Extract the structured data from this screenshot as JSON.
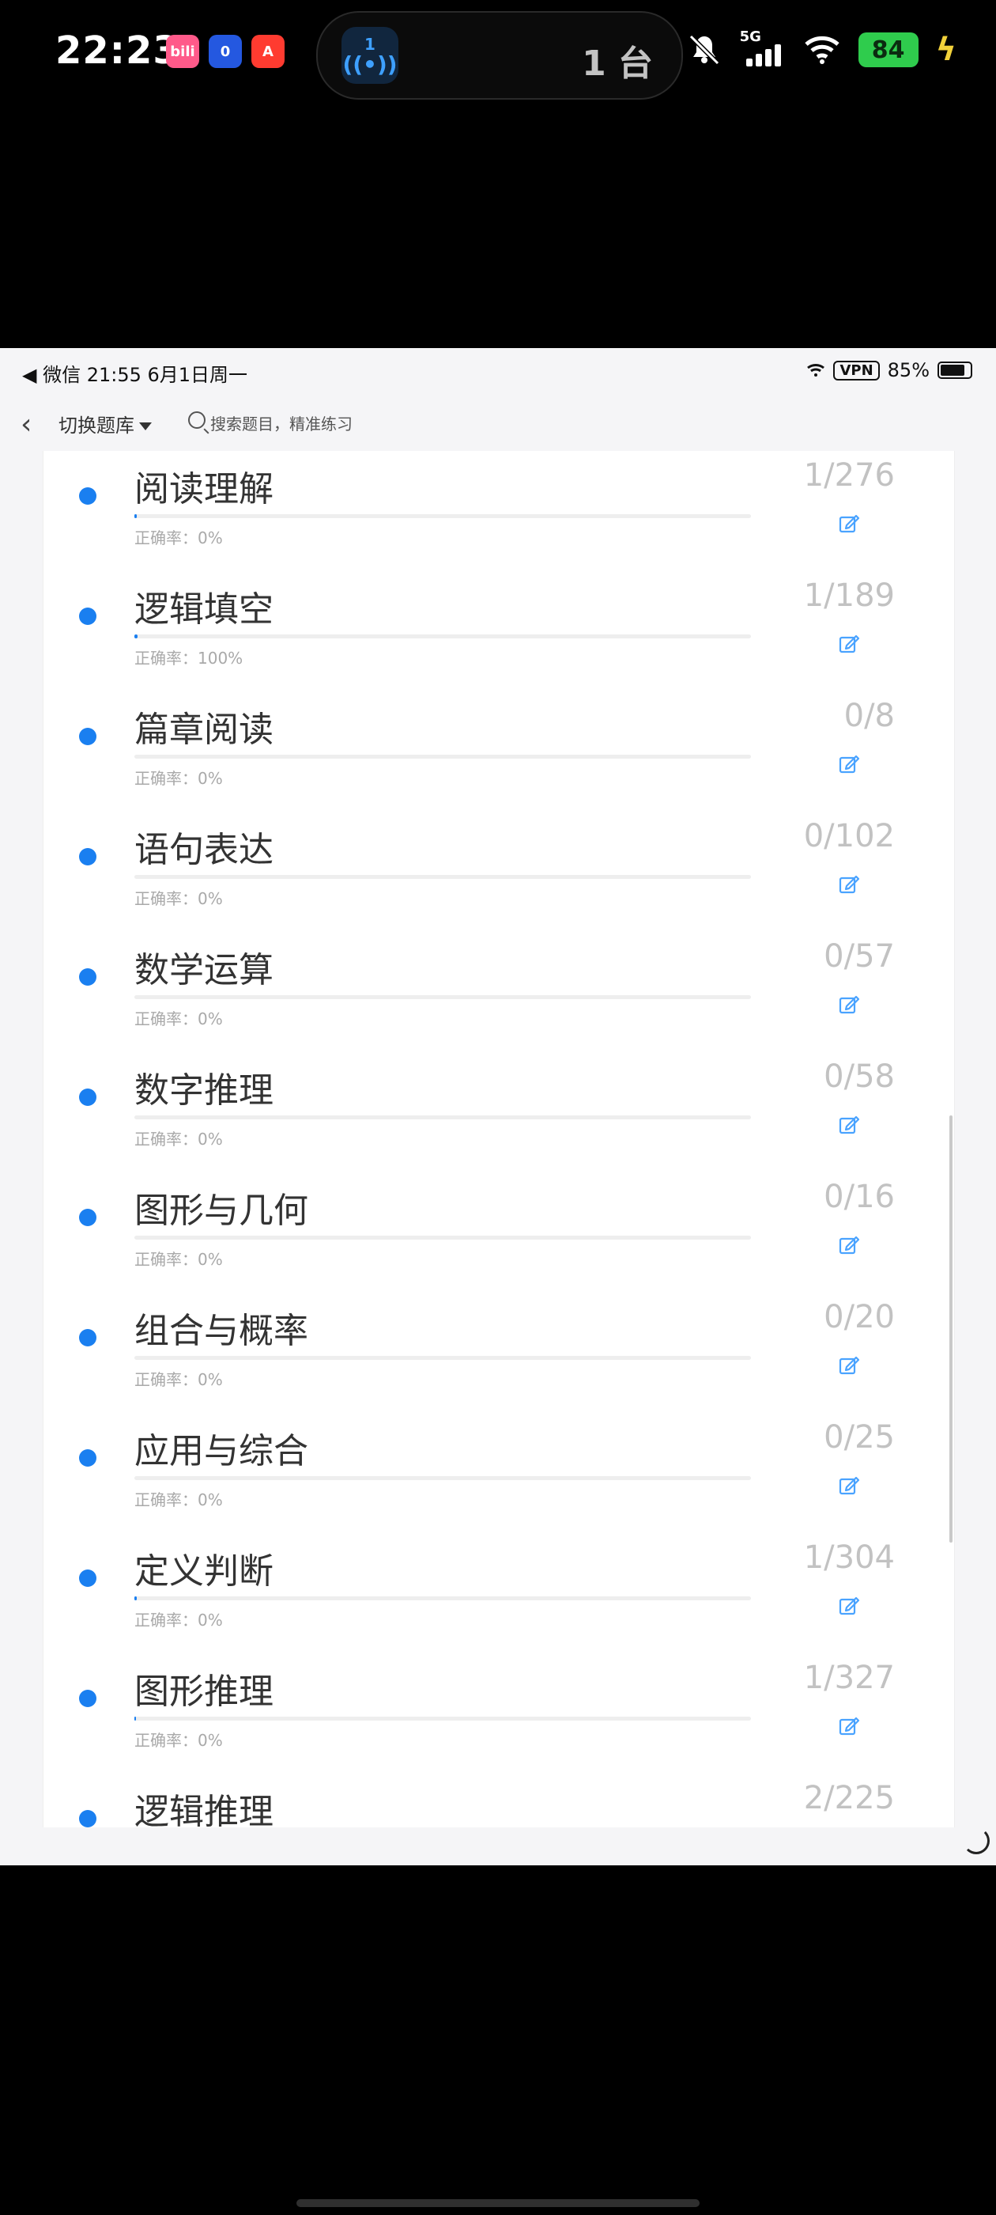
{
  "phone_status": {
    "time": "22:23",
    "cast_badge_number": "1",
    "devices_text": "1 台",
    "network_type": "5G",
    "battery": "84"
  },
  "inner_status": {
    "left_text": "◀ 微信   21:55   6月1日周一",
    "vpn": "VPN",
    "battery": "85%"
  },
  "inner_nav": {
    "back_icon": "chevron-left-icon",
    "title": "切换题库",
    "search_placeholder": "搜索题目，精准练习"
  },
  "list_items": [
    {
      "title": "阅读理解",
      "accuracy": "正确率：0%",
      "count": "1/276",
      "progress": 0.0036
    },
    {
      "title": "逻辑填空",
      "accuracy": "正确率：100%",
      "count": "1/189",
      "progress": 0.0053
    },
    {
      "title": "篇章阅读",
      "accuracy": "正确率：0%",
      "count": "0/8",
      "progress": 0
    },
    {
      "title": "语句表达",
      "accuracy": "正确率：0%",
      "count": "0/102",
      "progress": 0
    },
    {
      "title": "数学运算",
      "accuracy": "正确率：0%",
      "count": "0/57",
      "progress": 0
    },
    {
      "title": "数字推理",
      "accuracy": "正确率：0%",
      "count": "0/58",
      "progress": 0
    },
    {
      "title": "图形与几何",
      "accuracy": "正确率：0%",
      "count": "0/16",
      "progress": 0
    },
    {
      "title": "组合与概率",
      "accuracy": "正确率：0%",
      "count": "0/20",
      "progress": 0
    },
    {
      "title": "应用与综合",
      "accuracy": "正确率：0%",
      "count": "0/25",
      "progress": 0
    },
    {
      "title": "定义判断",
      "accuracy": "正确率：0%",
      "count": "1/304",
      "progress": 0.0033
    },
    {
      "title": "图形推理",
      "accuracy": "正确率：0%",
      "count": "1/327",
      "progress": 0.0031
    },
    {
      "title": "逻辑推理",
      "accuracy": "",
      "count": "2/225",
      "progress": 0.0089
    }
  ],
  "colors": {
    "accent": "#1a7ff0",
    "edit_icon": "#4aa3ff",
    "count_text": "#c2c2c2"
  }
}
